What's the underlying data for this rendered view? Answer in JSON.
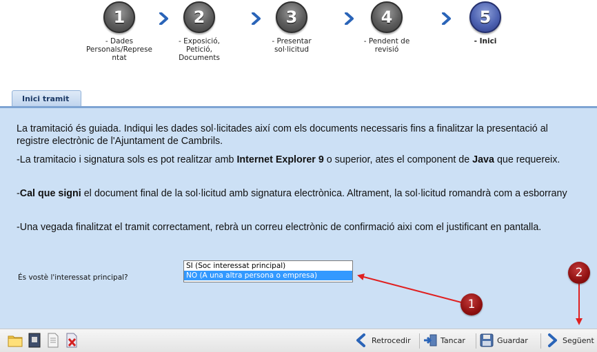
{
  "steps": [
    {
      "number": "1",
      "label": "- Dades Personals/Representat",
      "l1": "- Dades",
      "l2": "Personals/Represe",
      "l3": "ntat"
    },
    {
      "number": "2",
      "label": "- Exposició, Petició, Documents",
      "l1": "- Exposició,",
      "l2": "Petició,",
      "l3": "Documents"
    },
    {
      "number": "3",
      "label": "- Presentar sol·licitud",
      "l1": "- Presentar",
      "l2": "sol·licitud",
      "l3": ""
    },
    {
      "number": "4",
      "label": "- Pendent de revisió",
      "l1": "- Pendent de",
      "l2": "revisió",
      "l3": ""
    },
    {
      "number": "5",
      "label": "- Inici",
      "l1": "- Inici",
      "l2": "",
      "l3": ""
    }
  ],
  "tab": {
    "label": "Inici tramit"
  },
  "content": {
    "p1": "La tramitació és guiada. Indiqui les dades sol·licitades així com els documents necessaris fins a finalitzar la presentació al registre electrònic de l'Ajuntament de Cambrils.",
    "p2_a": "-La tramitacio i signatura sols es pot realitzar amb ",
    "p2_b": "Internet Explorer 9",
    "p2_c": " o superior, ates el component de ",
    "p2_d": "Java",
    "p2_e": " que requereix.",
    "p3_a": "-",
    "p3_b": "Cal que signi",
    "p3_c": " el document final de la sol·licitud amb signatura electrònica. Altrament, la sol·licitud romandrà com a esborrany",
    "p4": "-Una vegada finalitzat el tramit correctament, rebrà un correu electrònic de confirmació aixi com el justificant en pantalla."
  },
  "question": {
    "label": "És vostè l'interessat principal?",
    "options": [
      "SI (Soc interessat principal)",
      "NO (A una altra persona o empresa)"
    ],
    "selected": "NO (A una altra persona o empresa)"
  },
  "annotations": {
    "badge1": "1",
    "badge2": "2",
    "arrow_color": "#e02020"
  },
  "toolbar": {
    "left_icons": [
      "folder-icon",
      "dark-document-icon",
      "document-icon",
      "delete-document-icon"
    ],
    "back_label": "Retrocedir",
    "close_label": "Tancar",
    "save_label": "Guardar",
    "next_label": "Següent"
  },
  "colors": {
    "panel_bg": "#cce0f5",
    "tab_line": "#7ea4d3",
    "active_step": "#4e63b2"
  }
}
